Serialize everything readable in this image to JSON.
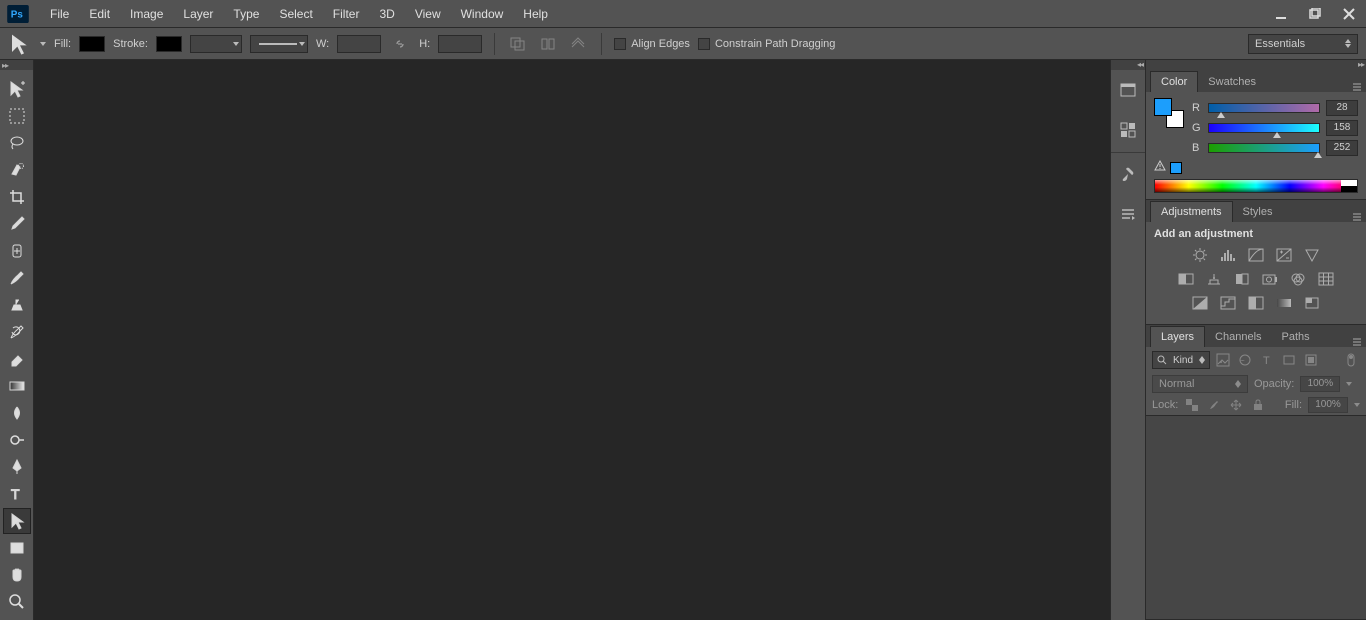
{
  "menu": {
    "items": [
      "File",
      "Edit",
      "Image",
      "Layer",
      "Type",
      "Select",
      "Filter",
      "3D",
      "View",
      "Window",
      "Help"
    ]
  },
  "options": {
    "fill_label": "Fill:",
    "stroke_label": "Stroke:",
    "w_label": "W:",
    "h_label": "H:",
    "align_edges": "Align Edges",
    "constrain": "Constrain Path Dragging",
    "workspace": "Essentials"
  },
  "panels": {
    "color": {
      "tab": "Color",
      "swatches_tab": "Swatches",
      "r_label": "R",
      "g_label": "G",
      "b_label": "B",
      "r_val": "28",
      "g_val": "158",
      "b_val": "252",
      "fg_color": "#1c9efc"
    },
    "adjustments": {
      "tab": "Adjustments",
      "styles_tab": "Styles",
      "header": "Add an adjustment"
    },
    "layers": {
      "tab": "Layers",
      "channels_tab": "Channels",
      "paths_tab": "Paths",
      "kind": "Kind",
      "blend": "Normal",
      "opacity_label": "Opacity:",
      "opacity_val": "100%",
      "lock_label": "Lock:",
      "fill_label": "Fill:",
      "fill_val": "100%"
    }
  }
}
